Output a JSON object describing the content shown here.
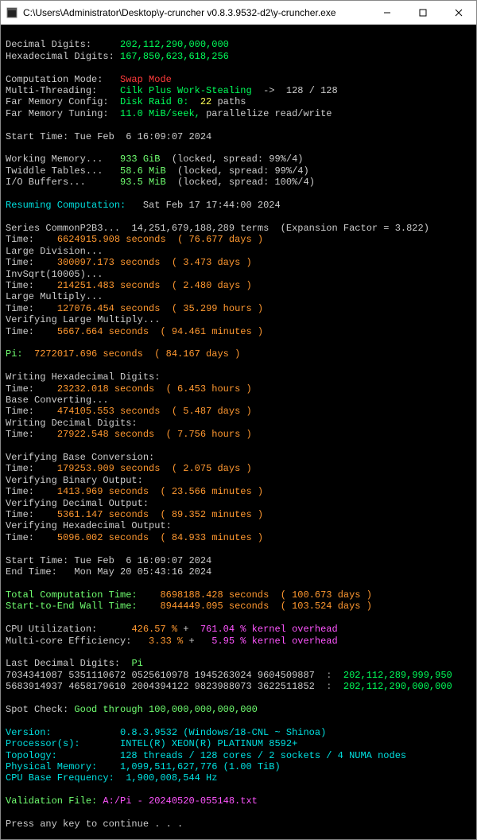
{
  "window": {
    "title": "C:\\Users\\Administrator\\Desktop\\y-cruncher v0.8.3.9532-d2\\y-cruncher.exe"
  },
  "header": {
    "decimal_label": "Decimal Digits:",
    "decimal_value": "202,112,290,000,000",
    "hex_label": "Hexadecimal Digits:",
    "hex_value": "167,850,623,618,256"
  },
  "mode": {
    "comp_label": "Computation Mode:",
    "comp_value": "Swap Mode",
    "mt_label": "Multi-Threading:",
    "mt_value": "Cilk Plus Work-Stealing",
    "mt_arrow": "->",
    "mt_threads": "128 / 128",
    "fm_cfg_label": "Far Memory Config:",
    "fm_cfg_value": "Disk Raid 0:",
    "fm_cfg_paths_n": "22",
    "fm_cfg_paths_w": "paths",
    "fm_tune_label": "Far Memory Tuning:",
    "fm_tune_speed": "11.0 MiB/seek,",
    "fm_tune_mode": "parallelize read/write"
  },
  "start": {
    "label": "Start Time:",
    "value": "Tue Feb  6 16:09:07 2024"
  },
  "mem": {
    "wm_label": "Working Memory...",
    "wm_value": "933 GiB",
    "wm_status": "(locked, spread: 99%/4)",
    "tt_label": "Twiddle Tables...",
    "tt_value": "58.6 MiB",
    "tt_status": "(locked, spread: 99%/4)",
    "io_label": "I/O Buffers...",
    "io_value": "93.5 MiB",
    "io_status": "(locked, spread: 100%/4)"
  },
  "resume": {
    "label": "Resuming Computation:",
    "value": "Sat Feb 17 17:44:00 2024"
  },
  "stages": {
    "series_label": "Series CommonP2B3...",
    "series_terms": "14,251,679,188,289 terms",
    "series_factor": "(Expansion Factor = 3.822)",
    "s_time_label": "Time:",
    "s_time_val": "6624915.908 seconds",
    "s_time_days": "( 76.677 days )",
    "ld_label": "Large Division...",
    "ld_time_val": "300097.173 seconds",
    "ld_time_days": "( 3.473 days )",
    "inv_label": "InvSqrt(10005)...",
    "inv_time_val": "214251.483 seconds",
    "inv_time_days": "( 2.480 days )",
    "lm_label": "Large Multiply...",
    "lm_time_val": "127076.454 seconds",
    "lm_time_days": "( 35.299 hours )",
    "vlm_label": "Verifying Large Multiply...",
    "vlm_time_val": "5667.664 seconds",
    "vlm_time_days": "( 94.461 minutes )"
  },
  "pi": {
    "label": "Pi:",
    "time_val": "7272017.696 seconds",
    "time_days": "( 84.167 days )"
  },
  "write": {
    "hex_label": "Writing Hexadecimal Digits:",
    "hex_val": "23232.018 seconds",
    "hex_days": "( 6.453 hours )",
    "bc_label": "Base Converting...",
    "bc_val": "474105.553 seconds",
    "bc_days": "( 5.487 days )",
    "dec_label": "Writing Decimal Digits:",
    "dec_val": "27922.548 seconds",
    "dec_days": "( 7.756 hours )"
  },
  "verify": {
    "bc_label": "Verifying Base Conversion:",
    "bc_val": "179253.909 seconds",
    "bc_days": "( 2.075 days )",
    "bo_label": "Verifying Binary Output:",
    "bo_val": "1413.969 seconds",
    "bo_days": "( 23.566 minutes )",
    "do_label": "Verifying Decimal Output:",
    "do_val": "5361.147 seconds",
    "do_days": "( 89.352 minutes )",
    "ho_label": "Verifying Hexadecimal Output:",
    "ho_val": "5096.002 seconds",
    "ho_days": "( 84.933 minutes )"
  },
  "times": {
    "start_label": "Start Time:",
    "start_val": "Tue Feb  6 16:09:07 2024",
    "end_label": "End Time:",
    "end_val": "Mon May 20 05:43:16 2024",
    "tct_label": "Total Computation Time:",
    "tct_val": "8698188.428 seconds",
    "tct_days": "( 100.673 days )",
    "wall_label": "Start-to-End Wall Time:",
    "wall_val": "8944449.095 seconds",
    "wall_days": "( 103.524 days )"
  },
  "cpu": {
    "util_label": "CPU Utilization:",
    "util_val": "426.57 %",
    "plus": "+",
    "util_over": "761.04 % kernel overhead",
    "mc_label": "Multi-core Efficiency:",
    "mc_val": "3.33 %",
    "mc_over": "5.95 % kernel overhead"
  },
  "digits": {
    "label": "Last Decimal Digits:",
    "constant": "Pi",
    "r1_d1": "7034341087",
    "r1_d2": "5351110672",
    "r1_d3": "0525610978",
    "r1_d4": "1945263024",
    "r1_d5": "9604509887",
    "r1_idx": "202,112,289,999,950",
    "r2_d1": "5683914937",
    "r2_d2": "4658179610",
    "r2_d3": "2004394122",
    "r2_d4": "9823988073",
    "r2_d5": "3622511852",
    "r2_idx": "202,112,290,000,000",
    "colon": ":"
  },
  "spot": {
    "label": "Spot Check:",
    "value": "Good through 100,000,000,000,000"
  },
  "sys": {
    "ver_label": "Version:",
    "ver_val": "0.8.3.9532 (Windows/18-CNL ~ Shinoa)",
    "proc_label": "Processor(s):",
    "proc_val": "INTEL(R) XEON(R) PLATINUM 8592+",
    "topo_label": "Topology:",
    "topo_val": "128 threads / 128 cores / 2 sockets / 4 NUMA nodes",
    "mem_label": "Physical Memory:",
    "mem_val": "1,099,511,627,776 (1.00 TiB)",
    "freq_label": "CPU Base Frequency:",
    "freq_val": "1,900,008,544 Hz"
  },
  "valfile": {
    "label": "Validation File:",
    "value": "A:/Pi - 20240520-055148.txt"
  },
  "footer": {
    "prompt": "Press any key to continue . . ."
  }
}
